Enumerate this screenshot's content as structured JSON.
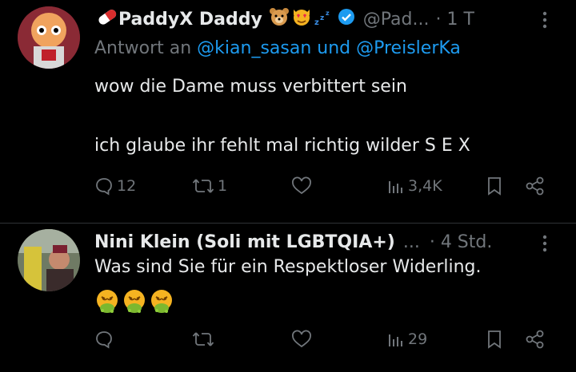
{
  "tweets": [
    {
      "author_name": "PaddyX Daddy",
      "author_handle": "@Pad...",
      "time": "· 1 T",
      "reply_prefix": "Antwort an",
      "reply_mentions": "@kian_sasan und @PreislerKa",
      "text_lines": [
        "wow die Dame muss verbittert sein",
        "ich glaube ihr fehlt mal richtig wilder S E X"
      ],
      "stats": {
        "replies": "12",
        "reposts": "1",
        "likes": "",
        "views": "3,4K"
      }
    },
    {
      "author_name": "Nini Klein (Soli mit LGBTQIA+)",
      "author_handle": "...",
      "time": "· 4 Std.",
      "text_lines": [
        "Was sind Sie für ein Respektloser Widerling."
      ],
      "stats": {
        "replies": "",
        "reposts": "",
        "likes": "",
        "views": "29"
      }
    }
  ],
  "colors": {
    "accent": "#1d9bf0",
    "muted": "#71767b",
    "text": "#e7e9ea",
    "background": "#000000"
  }
}
